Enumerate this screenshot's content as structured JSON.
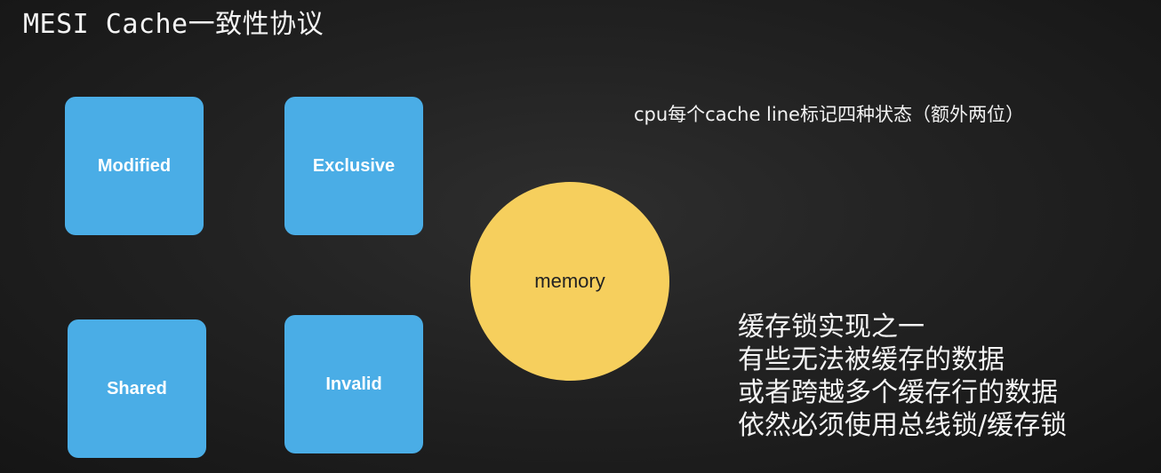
{
  "title": "MESI Cache一致性协议",
  "states": [
    {
      "label": "Modified"
    },
    {
      "label": "Exclusive"
    },
    {
      "label": "Shared"
    },
    {
      "label": "Invalid"
    }
  ],
  "memory": {
    "label": "memory"
  },
  "note": "cpu每个cache line标记四种状态（额外两位）",
  "points": [
    "缓存锁实现之一",
    "有些无法被缓存的数据",
    "或者跨越多个缓存行的数据",
    "依然必须使用总线锁/缓存锁"
  ],
  "colors": {
    "state_box": "#4aade6",
    "memory_circle": "#f6cf5d",
    "background": "#1c1c1c"
  }
}
